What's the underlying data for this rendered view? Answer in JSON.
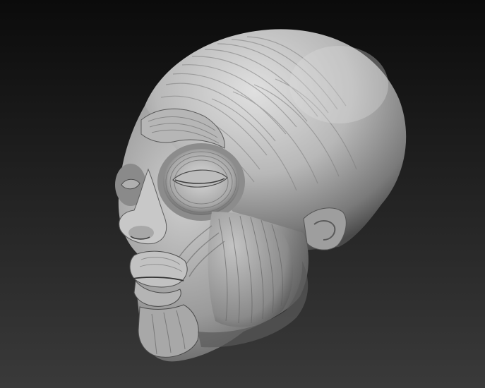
{
  "scene": {
    "subject": "ecorche-head-sculpt",
    "background_colors": {
      "top": "#0b0b0b",
      "bottom": "#3a3a3a"
    },
    "material_colors": {
      "light": "#d6d6d6",
      "mid": "#8e8e8e",
      "dark": "#2c2c2c"
    }
  }
}
